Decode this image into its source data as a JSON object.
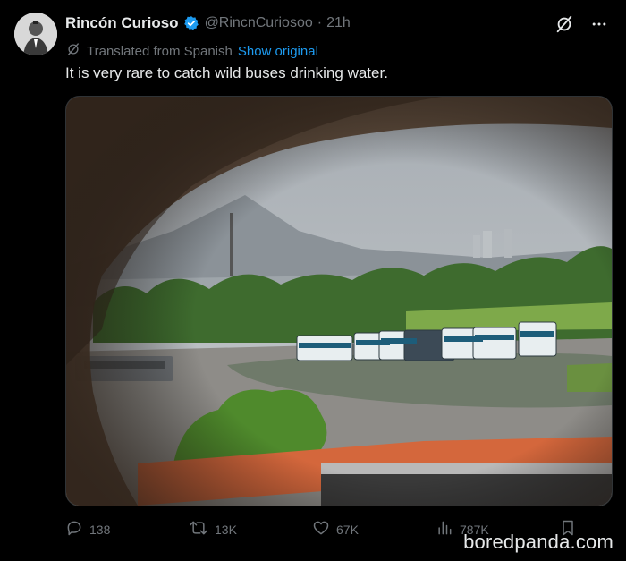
{
  "author": {
    "display_name": "Rincón Curioso",
    "handle": "@RincnCuriosoo",
    "separator": "·",
    "time": "21h"
  },
  "translation": {
    "notice": "Translated from Spanish",
    "show_original": "Show original"
  },
  "tweet": {
    "text": "It is very rare to catch wild buses drinking water."
  },
  "stats": {
    "replies": "138",
    "reposts": "13K",
    "likes": "67K",
    "views": "787K"
  },
  "watermark": "boredpanda.com",
  "colors": {
    "background": "#000000",
    "text": "#e7e9ea",
    "muted": "#71767b",
    "link": "#1d9bf0",
    "verified": "#1d9bf0"
  },
  "icons": [
    "grok-slash-icon",
    "more-icon",
    "translate-icon",
    "reply-icon",
    "repost-icon",
    "like-icon",
    "views-icon",
    "bookmark-icon",
    "verified-badge-icon"
  ]
}
